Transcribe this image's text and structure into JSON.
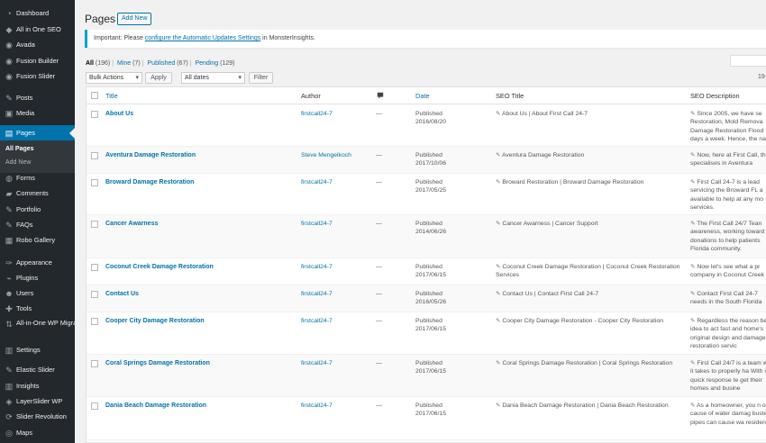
{
  "sidebar": {
    "items": [
      {
        "label": "Dashboard",
        "icon": "dashboard-icon",
        "glyph": "◔"
      },
      {
        "label": "All in One SEO",
        "icon": "seo-icon",
        "glyph": "◆"
      },
      {
        "label": "Avada",
        "icon": "avada-icon",
        "glyph": "◉"
      },
      {
        "label": "Fusion Builder",
        "icon": "fusion-builder-icon",
        "glyph": "◉"
      },
      {
        "label": "Fusion Slider",
        "icon": "fusion-slider-icon",
        "glyph": "◉"
      },
      {
        "label": "Posts",
        "icon": "pin-icon",
        "glyph": "✎"
      },
      {
        "label": "Media",
        "icon": "media-icon",
        "glyph": "▣"
      },
      {
        "label": "Pages",
        "icon": "pages-icon",
        "glyph": "▤"
      },
      {
        "label": "Forms",
        "icon": "forms-icon",
        "glyph": "◍"
      },
      {
        "label": "Comments",
        "icon": "comments-icon",
        "glyph": "▰"
      },
      {
        "label": "Portfolio",
        "icon": "portfolio-icon",
        "glyph": "✎"
      },
      {
        "label": "FAQs",
        "icon": "faqs-icon",
        "glyph": "✎"
      },
      {
        "label": "Robo Gallery",
        "icon": "gallery-icon",
        "glyph": "▦"
      },
      {
        "label": "Appearance",
        "icon": "appearance-icon",
        "glyph": "✑"
      },
      {
        "label": "Plugins",
        "icon": "plugins-icon",
        "glyph": "⌁"
      },
      {
        "label": "Users",
        "icon": "users-icon",
        "glyph": "☻"
      },
      {
        "label": "Tools",
        "icon": "tools-icon",
        "glyph": "✚"
      },
      {
        "label": "All-in-One WP Migration",
        "icon": "migration-icon",
        "glyph": "⇅"
      },
      {
        "label": "Settings",
        "icon": "settings-icon",
        "glyph": "▥"
      },
      {
        "label": "Elastic Slider",
        "icon": "elastic-slider-icon",
        "glyph": "✎"
      },
      {
        "label": "Insights",
        "icon": "insights-icon",
        "glyph": "▥"
      },
      {
        "label": "LayerSlider WP",
        "icon": "layerslider-icon",
        "glyph": "◈"
      },
      {
        "label": "Slider Revolution",
        "icon": "slider-revolution-icon",
        "glyph": "⟳"
      },
      {
        "label": "Maps",
        "icon": "maps-icon",
        "glyph": "◎"
      }
    ],
    "submenu": {
      "all_pages": "All Pages",
      "add_new": "Add New"
    }
  },
  "header": {
    "title": "Pages",
    "add_new": "Add New"
  },
  "notice": {
    "prefix": "Important: Please ",
    "link": "configure the Automatic Updates Settings",
    "suffix": " in MonsterInsights."
  },
  "filters": {
    "all_label": "All",
    "all_count": "(196)",
    "mine_label": "Mine",
    "mine_count": "(7)",
    "published_label": "Published",
    "published_count": "(67)",
    "pending_label": "Pending",
    "pending_count": "(129)"
  },
  "toolbar": {
    "bulk_actions": "Bulk Actions",
    "apply": "Apply",
    "all_dates": "All dates",
    "filter": "Filter",
    "items_count": "19"
  },
  "table": {
    "columns": {
      "title": "Title",
      "author": "Author",
      "date": "Date",
      "seo_title": "SEO Title",
      "seo_description": "SEO Description"
    },
    "rows": [
      {
        "title": "About Us",
        "author": "firstcall24-7",
        "comments": "—",
        "status": "Published",
        "date": "2016/08/20",
        "seo_title": "About Us | About First Call 24-7",
        "seo_desc": "Since 2005, we have se Restoration, Mold Remova Damage Restoration Flood days a week. Hence, the na"
      },
      {
        "title": "Aventura Damage Restoration",
        "author": "Steve Mengelkoch",
        "comments": "—",
        "status": "Published",
        "date": "2017/10/06",
        "seo_title": "Aventura Damage Restoration",
        "seo_desc": "Now, here at First Call, that specialises in Aventura"
      },
      {
        "title": "Broward Damage Restoration",
        "author": "firstcall24-7",
        "comments": "—",
        "status": "Published",
        "date": "2017/05/25",
        "seo_title": "Broward Restoration | Broward Damage Restoration",
        "seo_desc": "First Call 24-7 is a lead servicing the Broward FL a available to help at any mo services."
      },
      {
        "title": "Cancer Awarness",
        "author": "firstcall24-7",
        "comments": "—",
        "status": "Published",
        "date": "2014/06/26",
        "seo_title": "Cancer Awarness | Cancer Support",
        "seo_desc": "The First Call 24/7 Tean awareness, working toward donations to help patients Florida community."
      },
      {
        "title": "Coconut Creek Damage Restoration",
        "author": "firstcall24-7",
        "comments": "—",
        "status": "Published",
        "date": "2017/06/15",
        "seo_title": "Coconut Creek Damage Restoration | Coconut Creek Restoration Services",
        "seo_desc": "Now let's see what a pr company in Coconut Creek"
      },
      {
        "title": "Contact Us",
        "author": "firstcall24-7",
        "comments": "—",
        "status": "Published",
        "date": "2016/05/26",
        "seo_title": "Contact Us | Contact First Call 24-7",
        "seo_desc": "Contact First Call 24-7 needs in the South Florida"
      },
      {
        "title": "Cooper City Damage Restoration",
        "author": "firstcall24-7",
        "comments": "—",
        "status": "Published",
        "date": "2017/06/15",
        "seo_title": "Cooper City Damage Restoration - Cooper City Restoration",
        "seo_desc": "Regardless the reason best idea to act fast and home's original design and damage restoration servic"
      },
      {
        "title": "Coral Springs Damage Restoration",
        "author": "firstcall24-7",
        "comments": "—",
        "status": "Published",
        "date": "2017/06/15",
        "seo_title": "Coral Springs Damage Restoration | Coral Springs Restoration",
        "seo_desc": "First Call 24/7 is a team what it takes to properly ha With our quick response te get their homes and busine"
      },
      {
        "title": "Dania Beach Damage Restoration",
        "author": "firstcall24-7",
        "comments": "—",
        "status": "Published",
        "date": "2017/06/15",
        "seo_title": "Dania Beach Damage Restoration | Dania Beach Restoration",
        "seo_desc": "As a homeowner, you n only cause of water damag busted pipes can cause wa residence."
      }
    ]
  }
}
